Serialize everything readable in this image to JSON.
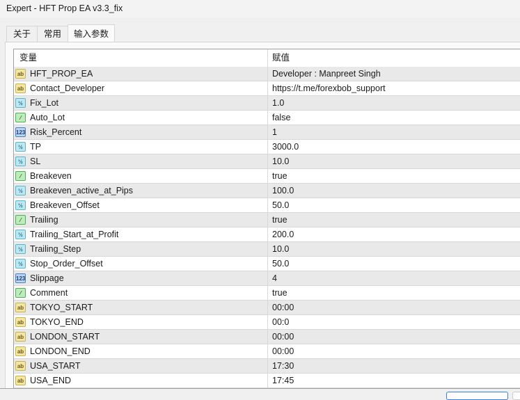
{
  "window": {
    "title": "Expert - HFT Prop EA v3.3_fix"
  },
  "tabs": [
    {
      "label": "关于"
    },
    {
      "label": "常用"
    },
    {
      "label": "输入参数"
    }
  ],
  "table": {
    "headers": {
      "variable": "变量",
      "value": "赋值"
    },
    "rows": [
      {
        "name": "HFT_PROP_EA",
        "value": "Developer : Manpreet Singh",
        "type": "string",
        "icon": "ab"
      },
      {
        "name": "Contact_Developer",
        "value": "https://t.me/forexbob_support",
        "type": "string",
        "icon": "ab"
      },
      {
        "name": "Fix_Lot",
        "value": "1.0",
        "type": "double",
        "icon": "½"
      },
      {
        "name": "Auto_Lot",
        "value": "false",
        "type": "bool",
        "icon": "⁄"
      },
      {
        "name": "Risk_Percent",
        "value": "1",
        "type": "int",
        "icon": "123"
      },
      {
        "name": "TP",
        "value": "3000.0",
        "type": "double",
        "icon": "½"
      },
      {
        "name": "SL",
        "value": "10.0",
        "type": "double",
        "icon": "½"
      },
      {
        "name": "Breakeven",
        "value": "true",
        "type": "bool",
        "icon": "⁄"
      },
      {
        "name": "Breakeven_active_at_Pips",
        "value": "100.0",
        "type": "double",
        "icon": "½"
      },
      {
        "name": "Breakeven_Offset",
        "value": "50.0",
        "type": "double",
        "icon": "½"
      },
      {
        "name": "Trailing",
        "value": "true",
        "type": "bool",
        "icon": "⁄"
      },
      {
        "name": "Trailing_Start_at_Profit",
        "value": "200.0",
        "type": "double",
        "icon": "½"
      },
      {
        "name": "Trailing_Step",
        "value": "10.0",
        "type": "double",
        "icon": "½"
      },
      {
        "name": "Stop_Order_Offset",
        "value": "50.0",
        "type": "double",
        "icon": "½"
      },
      {
        "name": "Slippage",
        "value": "4",
        "type": "int",
        "icon": "123"
      },
      {
        "name": "Comment",
        "value": "true",
        "type": "bool",
        "icon": "⁄"
      },
      {
        "name": "TOKYO_START",
        "value": "00:00",
        "type": "string",
        "icon": "ab"
      },
      {
        "name": "TOKYO_END",
        "value": "00:0",
        "type": "string",
        "icon": "ab"
      },
      {
        "name": "LONDON_START",
        "value": "00:00",
        "type": "string",
        "icon": "ab"
      },
      {
        "name": "LONDON_END",
        "value": "00:00",
        "type": "string",
        "icon": "ab"
      },
      {
        "name": "USA_START",
        "value": "17:30",
        "type": "string",
        "icon": "ab"
      },
      {
        "name": "USA_END",
        "value": "17:45",
        "type": "string",
        "icon": "ab"
      }
    ]
  }
}
